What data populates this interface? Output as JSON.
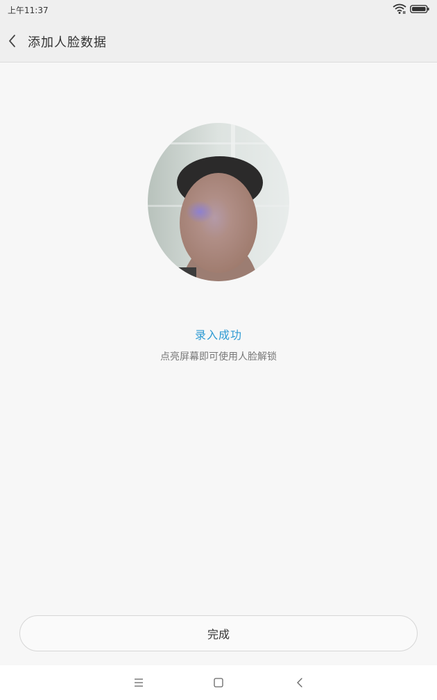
{
  "status_bar": {
    "time": "上午11:37",
    "icons": [
      "wifi-icon",
      "battery-icon"
    ]
  },
  "header": {
    "back_icon": "chevron-left-icon",
    "title": "添加人脸数据"
  },
  "preview": {
    "image": "face-preview-photo"
  },
  "result": {
    "title": "录入成功",
    "subtitle": "点亮屏幕即可使用人脸解锁"
  },
  "actions": {
    "done_label": "完成"
  },
  "nav_bar": {
    "icons": [
      "menu-icon",
      "home-icon",
      "back-icon"
    ]
  },
  "colors": {
    "accent": "#2e9ad3",
    "background": "#f7f7f7",
    "header": "#efefef"
  }
}
